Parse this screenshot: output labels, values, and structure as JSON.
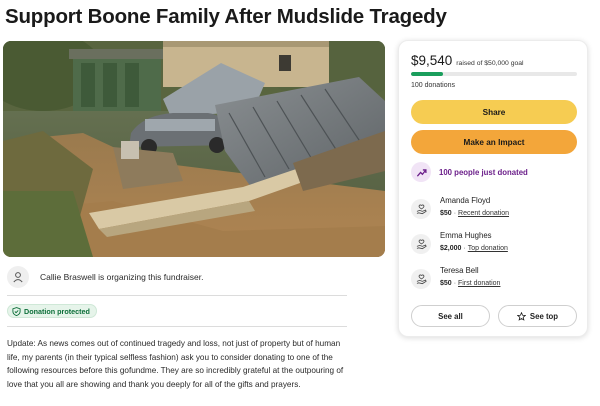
{
  "page": {
    "title": "Support Boone Family After Mudslide Tragedy"
  },
  "photo": {
    "description_icon": "mudslide-photo"
  },
  "organizer": {
    "text": "Callie Braswell is organizing this fundraiser.",
    "icon": "person-icon"
  },
  "badge": {
    "label": "Donation protected",
    "icon": "shield-check-icon",
    "color": "#0d6f3a"
  },
  "update": {
    "text": "Update: As news comes out of continued tragedy and loss, not just of property but of human life, my parents (in their typical selfless fashion) ask you to consider donating to one of the following resources before this gofundme. They are so incredibly grateful at the outpouring of love that you all are showing and thank you deeply for all of the gifts and prayers."
  },
  "donation_card": {
    "raised": "$9,540",
    "goal_text": "raised of $50,000 goal",
    "progress_fraction": 0.19,
    "donation_count": "100 donations",
    "share_label": "Share",
    "impact_label": "Make an Impact",
    "trend_text": "100 people just donated",
    "donors": [
      {
        "name": "Amanda Floyd",
        "amount": "$50",
        "tag": "Recent donation"
      },
      {
        "name": "Emma Hughes",
        "amount": "$2,000",
        "tag": "Top donation"
      },
      {
        "name": "Teresa Bell",
        "amount": "$50",
        "tag": "First donation"
      }
    ],
    "see_all_label": "See all",
    "see_top_label": "See top",
    "colors": {
      "share": "#f6cc52",
      "impact": "#f3a63a",
      "progress": "#1a9e5c",
      "trend": "#6b1f8a"
    }
  }
}
